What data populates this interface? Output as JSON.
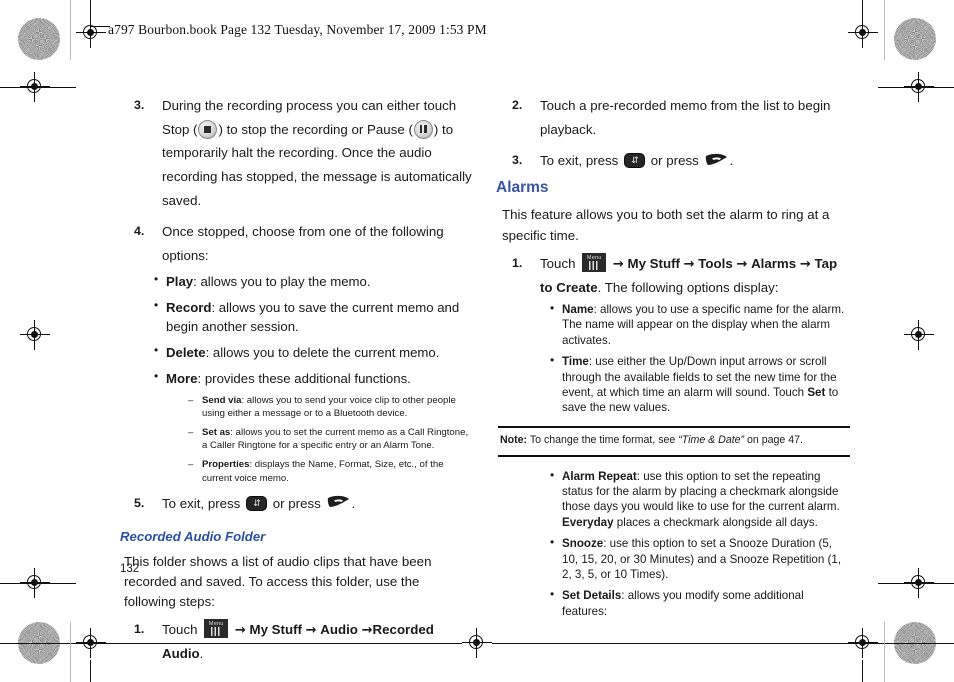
{
  "page": {
    "header": "a797 Bourbon.book  Page 132  Tuesday, November 17, 2009  1:53 PM",
    "page_number": "132",
    "accent_blue": "#3a55a8",
    "subhead_blue": "#2b4fa2"
  },
  "icons": {
    "stop": "stop-button-icon",
    "pause": "pause-button-icon",
    "back": "back-key-icon",
    "end": "end-call-key-icon",
    "menu": "menu-key-icon",
    "arrow": "→"
  },
  "left_column": {
    "step3": {
      "num": "3.",
      "t1": "During the recording process you can either touch Stop (",
      "t2": ") to stop the recording or Pause (",
      "t3": ") to temporarily halt the recording. Once the audio recording has stopped, the message is automatically saved."
    },
    "step4": {
      "num": "4.",
      "text": "Once stopped, choose from one of the following options:"
    },
    "options": [
      {
        "term": "Play",
        "desc": ": allows you to play the memo."
      },
      {
        "term": "Record",
        "desc": ": allows you to save the current memo and begin another session."
      },
      {
        "term": "Delete",
        "desc": ": allows you to delete the current memo."
      },
      {
        "term": "More",
        "desc": ": provides these additional functions."
      }
    ],
    "more_subitems": [
      {
        "term": "Send via",
        "desc": ": allows you to send your voice clip to other people using either a message or to a Bluetooth device."
      },
      {
        "term": "Set as",
        "desc": ": allows you to set the current memo as a Call Ringtone, a Caller Ringtone for a specific entry or an Alarm Tone."
      },
      {
        "term": "Properties",
        "desc": ": displays the Name, Format, Size, etc., of the current voice memo."
      }
    ],
    "step5": {
      "num": "5.",
      "t1": "To exit, press",
      "t2": "or press",
      "t3": "."
    },
    "subheading": "Recorded Audio Folder",
    "folder_para": "This folder shows a list of audio clips that have been recorded and saved. To access this folder, use the following steps:",
    "folder_step1": {
      "num": "1.",
      "t1": "Touch",
      "path": [
        "My Stuff",
        "Audio",
        "Recorded Audio"
      ],
      "tail": "."
    }
  },
  "right_column": {
    "step2": {
      "num": "2.",
      "text": "Touch a pre-recorded memo from the list to begin playback."
    },
    "step3": {
      "num": "3.",
      "t1": "To exit, press",
      "t2": "or press",
      "t3": "."
    },
    "heading": "Alarms",
    "intro": "This feature allows you to both set the alarm to ring at a specific time.",
    "step1": {
      "num": "1.",
      "t1": "Touch",
      "path": [
        "My Stuff",
        "Tools",
        "Alarms",
        "Tap to Create"
      ],
      "tail": ". The following options display:"
    },
    "options_a": [
      {
        "term": "Name",
        "desc": ": allows you to use a specific name for the alarm. The name will appear on the display when the alarm activates."
      },
      {
        "term": "Time",
        "desc_pre": ": use either the Up/Down input arrows or scroll through the available fields to set the new time for the event, at which time an alarm will sound. Touch ",
        "bold_mid": "Set",
        "desc_post": " to save the new values."
      }
    ],
    "note": {
      "label": "Note:",
      "pre": " To change the time format, see ",
      "italic": "“Time & Date”",
      "post": " on page 47."
    },
    "options_b": [
      {
        "term": "Alarm Repeat",
        "desc_pre": ": use this option to set the repeating status for the alarm by placing a checkmark alongside those days you would like to use for the current alarm. ",
        "bold_mid": "Everyday",
        "desc_post": " places a checkmark alongside all days."
      },
      {
        "term": "Snooze",
        "desc_pre": ": use this option to set a Snooze Duration (5, 10, 15, 20, or 30 Minutes) and a Snooze Repetition (1, 2, 3, 5, or 10 Times).",
        "bold_mid": "",
        "desc_post": ""
      },
      {
        "term": "Set Details",
        "desc_pre": ": allows you modify some additional features:",
        "bold_mid": "",
        "desc_post": ""
      }
    ]
  }
}
